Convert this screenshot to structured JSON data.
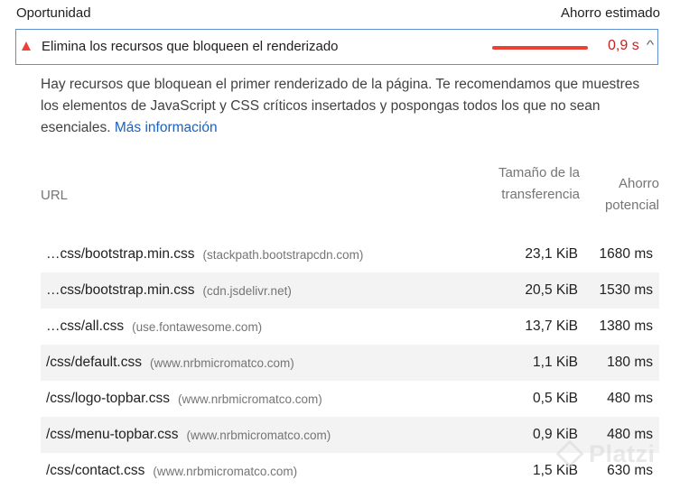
{
  "header": {
    "left_label": "Oportunidad",
    "right_label": "Ahorro estimado"
  },
  "audit": {
    "title": "Elimina los recursos que bloqueen el renderizado",
    "savings": "0,9 s",
    "status_icon": "warning-triangle-icon",
    "accent_color": "#eb4234",
    "expanded": true
  },
  "description": {
    "text": "Hay recursos que bloquean el primer renderizado de la página. Te recomendamos que muestres los elementos de JavaScript y CSS críticos insertados y pospongas todos los que no sean esenciales.",
    "link_text": "Más información"
  },
  "table": {
    "columns": {
      "url": "URL",
      "size": "Tamaño de la transferencia",
      "saving": "Ahorro potencial"
    },
    "rows": [
      {
        "path": "…css/bootstrap.min.css",
        "host": "(stackpath.bootstrapcdn.com)",
        "size": "23,1 KiB",
        "saving": "1680 ms"
      },
      {
        "path": "…css/bootstrap.min.css",
        "host": "(cdn.jsdelivr.net)",
        "size": "20,5 KiB",
        "saving": "1530 ms"
      },
      {
        "path": "…css/all.css",
        "host": "(use.fontawesome.com)",
        "size": "13,7 KiB",
        "saving": "1380 ms"
      },
      {
        "path": "/css/default.css",
        "host": "(www.nrbmicromatco.com)",
        "size": "1,1 KiB",
        "saving": "180 ms"
      },
      {
        "path": "/css/logo-topbar.css",
        "host": "(www.nrbmicromatco.com)",
        "size": "0,5 KiB",
        "saving": "480 ms"
      },
      {
        "path": "/css/menu-topbar.css",
        "host": "(www.nrbmicromatco.com)",
        "size": "0,9 KiB",
        "saving": "480 ms"
      },
      {
        "path": "/css/contact.css",
        "host": "(www.nrbmicromatco.com)",
        "size": "1,5 KiB",
        "saving": "630 ms"
      }
    ]
  },
  "watermark": {
    "text": "Platzi"
  }
}
